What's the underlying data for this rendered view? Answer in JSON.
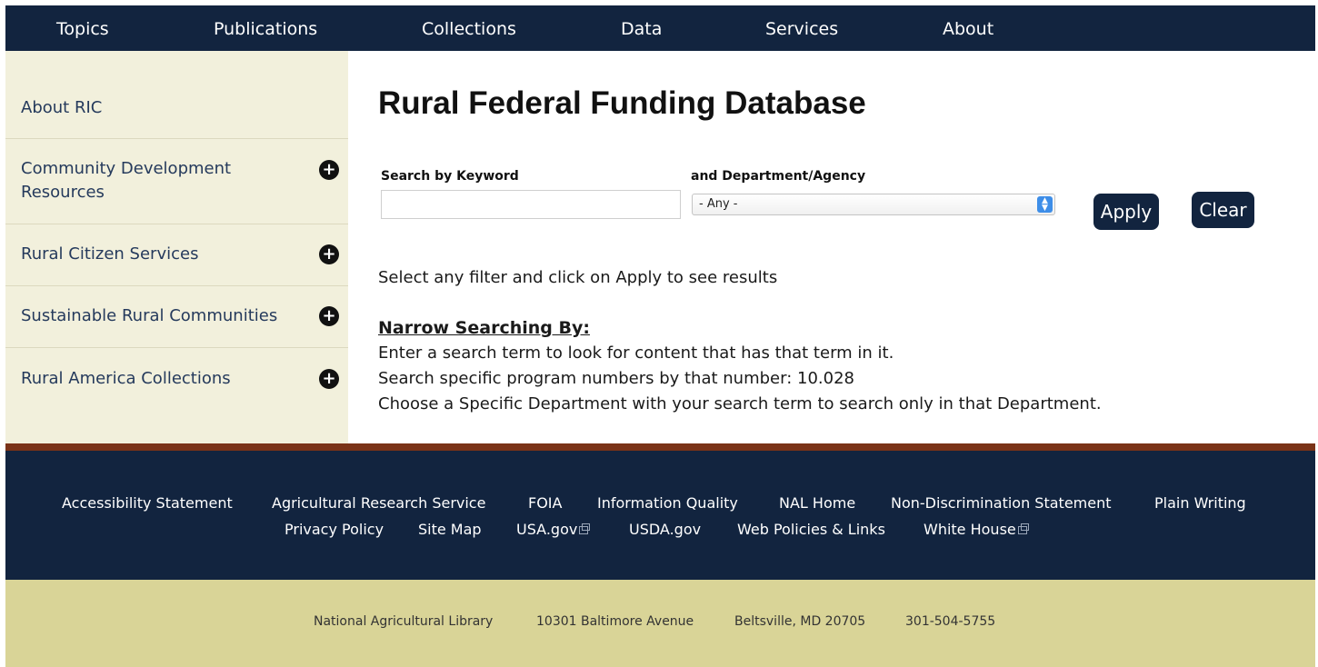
{
  "topnav": {
    "items": [
      {
        "label": "Topics"
      },
      {
        "label": "Publications"
      },
      {
        "label": "Collections"
      },
      {
        "label": "Data"
      },
      {
        "label": "Services"
      },
      {
        "label": "About"
      }
    ]
  },
  "sidebar": {
    "items": [
      {
        "label": "About RIC"
      },
      {
        "label": "Community Development Resources"
      },
      {
        "label": "Rural Citizen Services"
      },
      {
        "label": "Sustainable Rural Communities"
      },
      {
        "label": "Rural America Collections"
      }
    ],
    "expand_icon": "plus-circle-icon"
  },
  "main": {
    "title": "Rural Federal Funding Database",
    "keyword_label": "Search by Keyword",
    "keyword_value": "",
    "department_label": "and Department/Agency",
    "department_selected": "- Any -",
    "apply_label": "Apply",
    "clear_label": "Clear",
    "hint": "Select any filter and click on Apply to see results",
    "narrow_title": "Narrow Searching By:",
    "narrow_lines": [
      "Enter a search term to look for content that has that term in it.",
      "Search specific program numbers by that number: 10.028",
      "Choose a Specific Department with your search term to search only in that Department."
    ]
  },
  "footer": {
    "links_row1": [
      "Accessibility Statement",
      "Agricultural Research Service",
      "FOIA",
      "Information Quality",
      "NAL Home",
      "Non-Discrimination Statement",
      "Plain Writing"
    ],
    "links_row2": [
      "Privacy Policy",
      "Site Map",
      "USA.gov",
      "USDA.gov",
      "Web Policies & Links",
      "White House"
    ],
    "address": {
      "org": "National Agricultural Library",
      "street": "10301 Baltimore Avenue",
      "city": "Beltsville, MD 20705",
      "phone": "301-504-5755"
    }
  },
  "colors": {
    "navy": "#12243f",
    "sidebar_bg": "#f2f0dc",
    "rust": "#7a3318",
    "address_bg": "#d9d497"
  }
}
